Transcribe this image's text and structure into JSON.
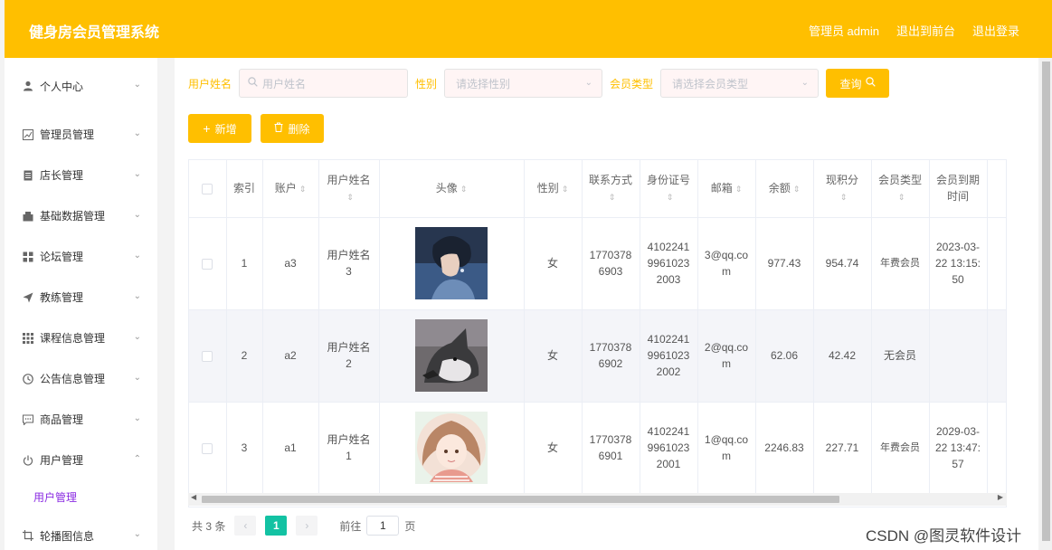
{
  "header": {
    "title": "健身房会员管理系统",
    "nav": [
      "管理员 admin",
      "退出到前台",
      "退出登录"
    ]
  },
  "sidebar": {
    "items": [
      {
        "label": "个人中心",
        "icon": "user-icon",
        "chevron": "down"
      },
      {
        "label": "管理员管理",
        "icon": "chart-icon",
        "chevron": "down"
      },
      {
        "label": "店长管理",
        "icon": "document-icon",
        "chevron": "down"
      },
      {
        "label": "基础数据管理",
        "icon": "database-icon",
        "chevron": "down"
      },
      {
        "label": "论坛管理",
        "icon": "grid-icon",
        "chevron": "down"
      },
      {
        "label": "教练管理",
        "icon": "send-icon",
        "chevron": "down"
      },
      {
        "label": "课程信息管理",
        "icon": "apps-icon",
        "chevron": "down"
      },
      {
        "label": "公告信息管理",
        "icon": "clock-icon",
        "chevron": "down"
      },
      {
        "label": "商品管理",
        "icon": "chat-icon",
        "chevron": "down"
      },
      {
        "label": "用户管理",
        "icon": "power-icon",
        "chevron": "up"
      },
      {
        "label": "轮播图信息",
        "icon": "crop-icon",
        "chevron": "down"
      }
    ],
    "submenu": {
      "label": "用户管理"
    }
  },
  "filter": {
    "name_label": "用户姓名",
    "name_placeholder": "用户姓名",
    "gender_label": "性别",
    "gender_placeholder": "请选择性别",
    "type_label": "会员类型",
    "type_placeholder": "请选择会员类型",
    "search_button": "查询"
  },
  "actions": {
    "add_button": "新增",
    "delete_button": "删除"
  },
  "table": {
    "headers": {
      "index": "索引",
      "account": "账户",
      "name": "用户姓名",
      "avatar": "头像",
      "gender": "性别",
      "phone": "联系方式",
      "idcard": "身份证号",
      "email": "邮箱",
      "balance": "余额",
      "points": "现积分",
      "member_type": "会员类型",
      "expire": "会员到期时间"
    },
    "rows": [
      {
        "index": "1",
        "account": "a3",
        "name": "用户姓名3",
        "avatar": "avatar-boy-blue",
        "gender": "女",
        "phone": "17703786903",
        "idcard": "410224199610232003",
        "email": "3@qq.com",
        "balance": "977.43",
        "points": "954.74",
        "member_type": "年费会员",
        "expire": "2023-03-22 13:15:50"
      },
      {
        "index": "2",
        "account": "a2",
        "name": "用户姓名2",
        "avatar": "avatar-husky",
        "gender": "女",
        "phone": "17703786902",
        "idcard": "410224199610232002",
        "email": "2@qq.com",
        "balance": "62.06",
        "points": "42.42",
        "member_type": "无会员",
        "expire": ""
      },
      {
        "index": "3",
        "account": "a1",
        "name": "用户姓名1",
        "avatar": "avatar-girl",
        "gender": "女",
        "phone": "17703786901",
        "idcard": "410224199610232001",
        "email": "1@qq.com",
        "balance": "2246.83",
        "points": "227.71",
        "member_type": "年费会员",
        "expire": "2029-03-22 13:47:57"
      }
    ]
  },
  "pagination": {
    "total": "共 3 条",
    "current_page": "1",
    "goto_label": "前往",
    "goto_value": "1",
    "page_suffix": "页"
  },
  "watermark": "CSDN @图灵软件设计",
  "colors": {
    "accent": "#ffbf00",
    "pager_active": "#13c2a3",
    "submenu_active": "#8a2be2"
  }
}
